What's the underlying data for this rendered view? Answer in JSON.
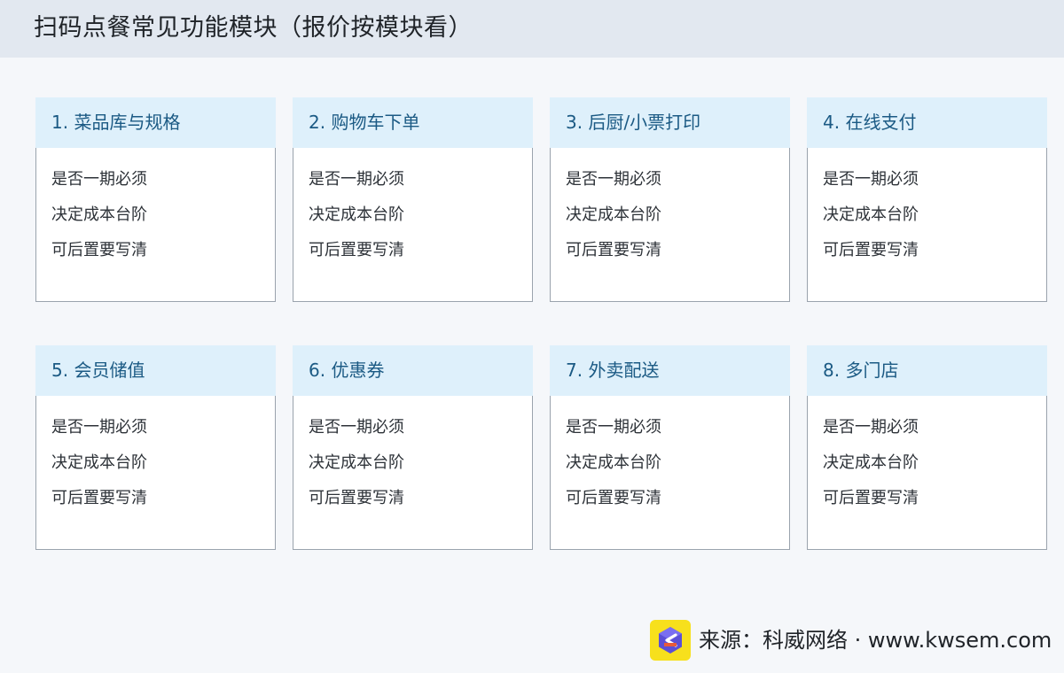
{
  "header": {
    "title": "扫码点餐常见功能模块（报价按模块看）"
  },
  "modules": [
    {
      "title": "1. 菜品库与规格",
      "lines": [
        "是否一期必须",
        "决定成本台阶",
        "可后置要写清"
      ]
    },
    {
      "title": "2. 购物车下单",
      "lines": [
        "是否一期必须",
        "决定成本台阶",
        "可后置要写清"
      ]
    },
    {
      "title": "3. 后厨/小票打印",
      "lines": [
        "是否一期必须",
        "决定成本台阶",
        "可后置要写清"
      ]
    },
    {
      "title": "4. 在线支付",
      "lines": [
        "是否一期必须",
        "决定成本台阶",
        "可后置要写清"
      ]
    },
    {
      "title": "5. 会员储值",
      "lines": [
        "是否一期必须",
        "决定成本台阶",
        "可后置要写清"
      ]
    },
    {
      "title": "6. 优惠券",
      "lines": [
        "是否一期必须",
        "决定成本台阶",
        "可后置要写清"
      ]
    },
    {
      "title": "7. 外卖配送",
      "lines": [
        "是否一期必须",
        "决定成本台阶",
        "可后置要写清"
      ]
    },
    {
      "title": "8. 多门店",
      "lines": [
        "是否一期必须",
        "决定成本台阶",
        "可后置要写清"
      ]
    }
  ],
  "footer": {
    "source_text": "来源：科威网络 · www.kwsem.com",
    "logo_icon": "kwsem-logo-icon"
  },
  "colors": {
    "header_bg": "#e2e8f0",
    "card_head_bg": "#def0fb",
    "card_title": "#1b5a84",
    "logo_bg": "#f7e01c"
  }
}
